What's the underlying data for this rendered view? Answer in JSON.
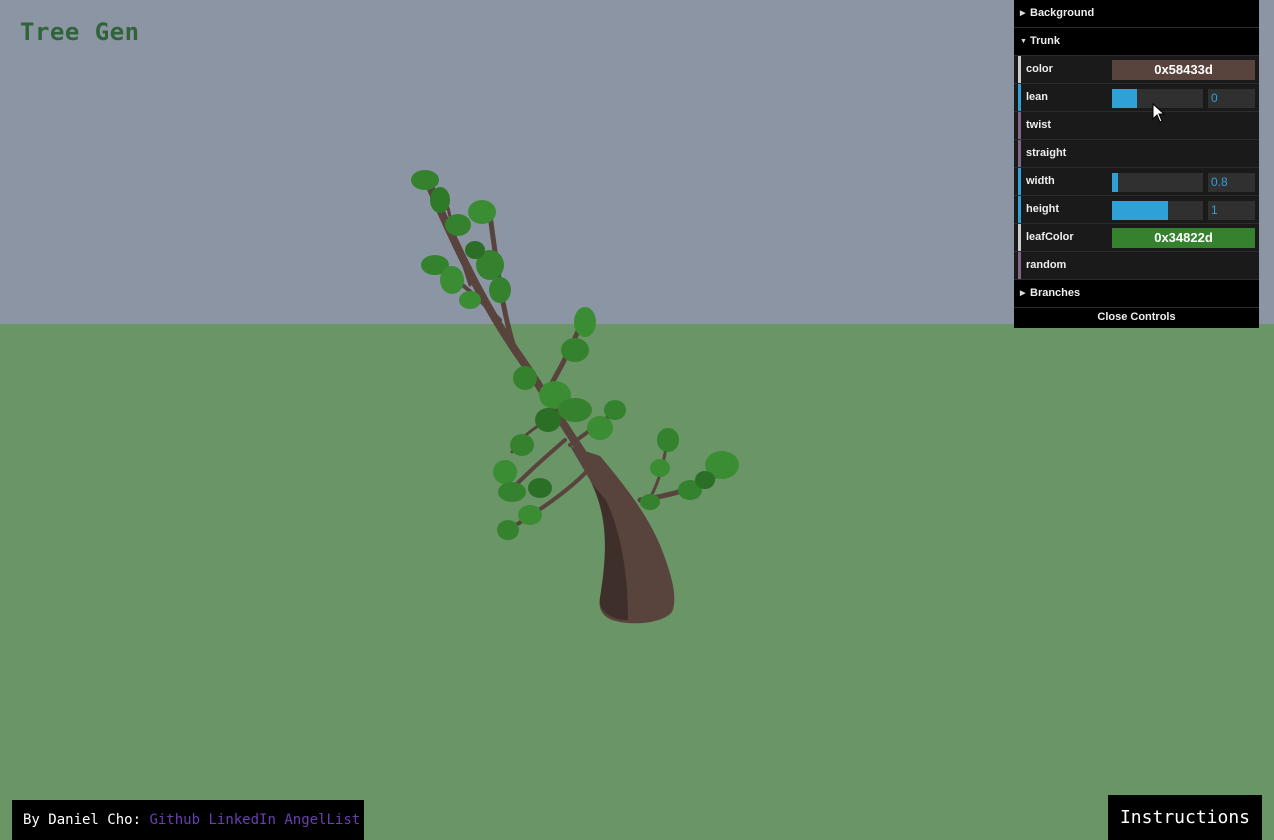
{
  "app": {
    "title": "Tree Gen"
  },
  "colors": {
    "sky": "#8c95a3",
    "ground": "#6a9566",
    "trunk": "#58433d",
    "leaf": "#34822d",
    "accent": "#2fa1d6"
  },
  "gui": {
    "folders": {
      "background": "Background",
      "trunk": "Trunk",
      "branches": "Branches"
    },
    "trunk_controls": {
      "color": {
        "label": "color",
        "value": "0x58433d"
      },
      "lean": {
        "label": "lean",
        "value": "0",
        "fill": 0.28
      },
      "twist": {
        "label": "twist"
      },
      "straight": {
        "label": "straight"
      },
      "width": {
        "label": "width",
        "value": "0.8",
        "fill": 0.07
      },
      "height": {
        "label": "height",
        "value": "1",
        "fill": 0.62
      },
      "leafColor": {
        "label": "leafColor",
        "value": "0x34822d"
      },
      "random": {
        "label": "random"
      }
    },
    "close_label": "Close Controls"
  },
  "footer": {
    "by_text": "By Daniel Cho:",
    "links": [
      "Github",
      "LinkedIn",
      "AngelList"
    ]
  },
  "instructions_label": "Instructions"
}
